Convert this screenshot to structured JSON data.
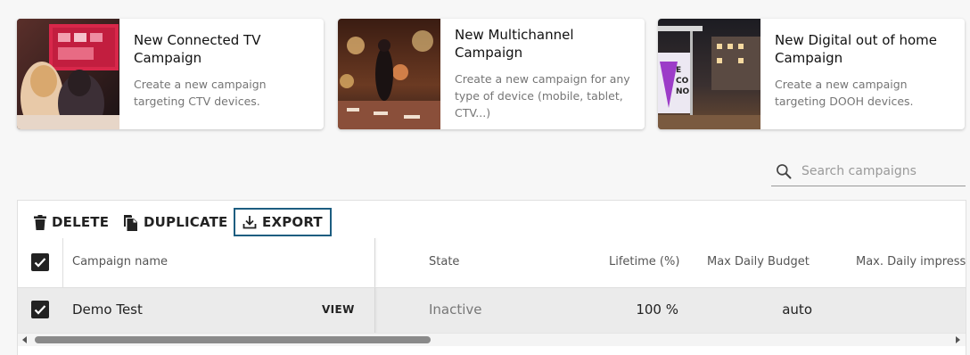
{
  "cards": [
    {
      "title": "New Connected TV Campaign",
      "description": "Create a new campaign targeting CTV devices.",
      "image": "tv-living-room-photo"
    },
    {
      "title": "New Multichannel Campaign",
      "description": "Create a new campaign for any type of device (mobile, tablet, CTV...)",
      "image": "city-street-night-photo"
    },
    {
      "title": "New Digital out of home Campaign",
      "description": "Create a new campaign targeting DOOH devices.",
      "image": "billboard-bus-stop-photo"
    }
  ],
  "search": {
    "placeholder": "Search campaigns",
    "value": "",
    "icon": "search-icon"
  },
  "toolbar": {
    "delete_label": "DELETE",
    "duplicate_label": "DUPLICATE",
    "export_label": "EXPORT",
    "export_focus_color": "#1c5d80"
  },
  "table": {
    "columns": [
      "Campaign name",
      "State",
      "Lifetime (%)",
      "Max Daily Budget",
      "Max. Daily impress"
    ],
    "header_checked": true,
    "rows": [
      {
        "checked": true,
        "name": "Demo Test",
        "action": "VIEW",
        "state": "Inactive",
        "lifetime": "100 %",
        "max_daily_budget": "auto",
        "max_daily_impressions": ""
      }
    ]
  }
}
